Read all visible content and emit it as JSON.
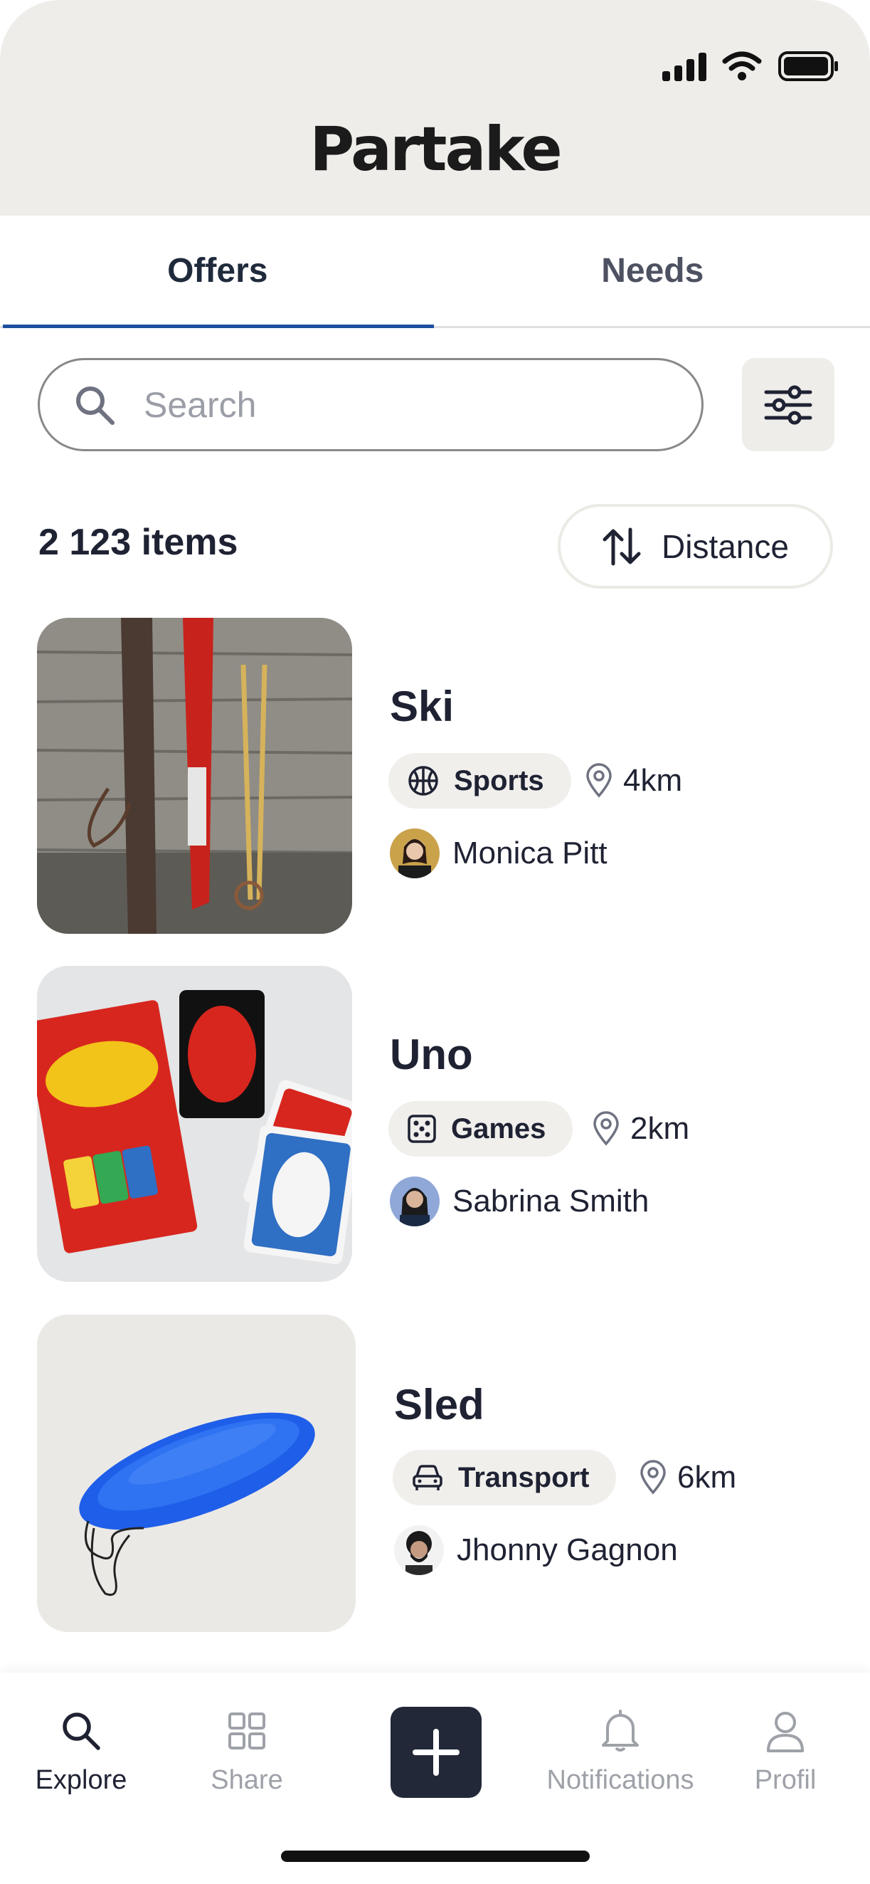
{
  "app": {
    "title": "Partake"
  },
  "tabs": [
    {
      "label": "Offers",
      "active": true
    },
    {
      "label": "Needs",
      "active": false
    }
  ],
  "search": {
    "placeholder": "Search"
  },
  "results": {
    "count_label": "2 123 items",
    "sort_label": "Distance"
  },
  "items": [
    {
      "title": "Ski",
      "category": "Sports",
      "category_icon": "basketball-icon",
      "distance": "4km",
      "owner": "Monica Pitt"
    },
    {
      "title": "Uno",
      "category": "Games",
      "category_icon": "dice-icon",
      "distance": "2km",
      "owner": "Sabrina Smith"
    },
    {
      "title": "Sled",
      "category": "Transport",
      "category_icon": "car-icon",
      "distance": "6km",
      "owner": "Jhonny Gagnon"
    }
  ],
  "nav": [
    {
      "label": "Explore",
      "icon": "search-icon",
      "active": true
    },
    {
      "label": "Share",
      "icon": "grid-icon",
      "active": false
    },
    {
      "label": "",
      "icon": "plus-icon",
      "active": false
    },
    {
      "label": "Notifications",
      "icon": "bell-icon",
      "active": false
    },
    {
      "label": "Profil",
      "icon": "user-icon",
      "active": false
    }
  ],
  "colors": {
    "header_bg": "#efedea",
    "accent": "#1e4f9f",
    "dark": "#222838",
    "text": "#1f2233"
  }
}
